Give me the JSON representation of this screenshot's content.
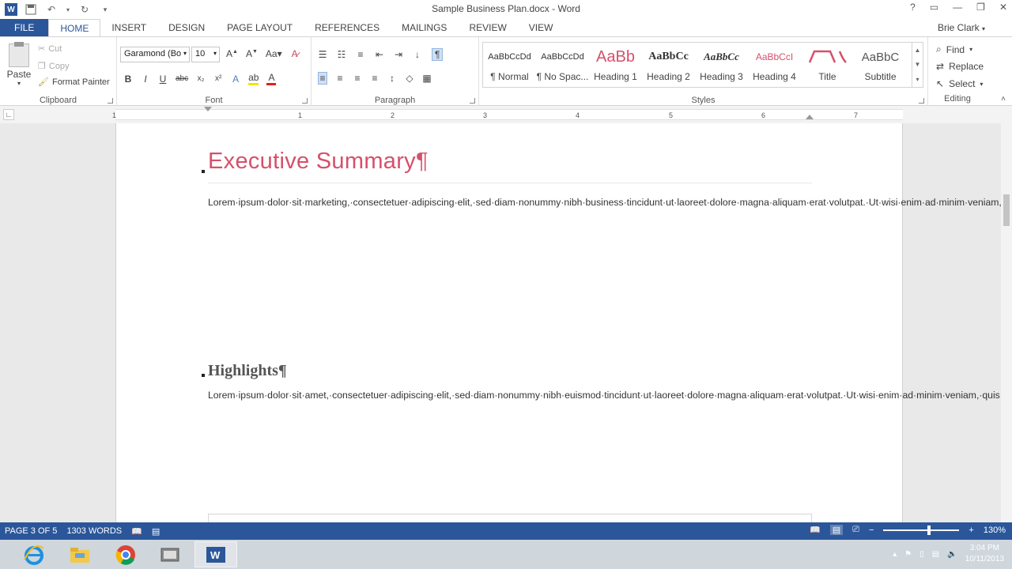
{
  "titlebar": {
    "title": "Sample Business Plan.docx - Word",
    "help": "?",
    "min": "—",
    "restore": "❐",
    "close": "✕"
  },
  "tabs": [
    "FILE",
    "HOME",
    "INSERT",
    "DESIGN",
    "PAGE LAYOUT",
    "REFERENCES",
    "MAILINGS",
    "REVIEW",
    "VIEW"
  ],
  "user": "Brie Clark",
  "clipboard": {
    "paste": "Paste",
    "cut": "Cut",
    "copy": "Copy",
    "format_painter": "Format Painter",
    "label": "Clipboard"
  },
  "font": {
    "name": "Garamond (Bo",
    "size": "10",
    "label": "Font",
    "buttons": [
      "B",
      "I",
      "U",
      "abc",
      "x₂",
      "x²"
    ]
  },
  "paragraph": {
    "label": "Paragraph"
  },
  "styles": {
    "label": "Styles",
    "items": [
      {
        "sample": "AaBbCcDd",
        "name": "¶ Normal"
      },
      {
        "sample": "AaBbCcDd",
        "name": "¶ No Spac..."
      },
      {
        "sample": "AaBb",
        "name": "Heading 1"
      },
      {
        "sample": "AaBbCc",
        "name": "Heading 2"
      },
      {
        "sample": "AaBbCc",
        "name": "Heading 3"
      },
      {
        "sample": "AaBbCcI",
        "name": "Heading 4"
      },
      {
        "sample": "",
        "name": "Title"
      },
      {
        "sample": "AaBbC",
        "name": "Subtitle"
      }
    ]
  },
  "editing": {
    "find": "Find",
    "replace": "Replace",
    "select": "Select",
    "label": "Editing"
  },
  "ruler": {
    "marks": [
      "1",
      "1",
      "2",
      "3",
      "4",
      "5",
      "6",
      "7"
    ]
  },
  "document": {
    "heading1": "Executive Summary¶",
    "para1": "Lorem·ipsum·dolor·sit·marketing,·consectetuer·adipiscing·elit,·sed·diam·nonummy·nibh·business·tincidunt·ut·laoreet·dolore·magna·aliquam·erat·volutpat.·Ut·wisi·enim·ad·minim·veniam,·quis·nostrud·exerci·tation·ullamcorper·suscipit·lobortis·nisl·ut·aliquip·ex·ea·commodo·consequat.·Duis·autem·vel·eum·iriure·dolor·in·hendrerit·in·vulputate·velit·esse·molestie·consequat,·vel·illum·dolore·eu·feugiat·nulla·facilisis·at·vero·eros·et·business·et·iusto·odio·dignissim·qui·blandit·praesent·luptatum·zzril·delenit·augue·duis·dolore·te·feugait·nulla·facilisi.·Nam·liber·tempor·cum·soluta·nobis·eleifend·option·congue·nihil·imperdiet·doming·id·quod·mazim·placerat·facer·possim·assum.·Typi·non·habent·claritatem·insitam;·est·usus·legentis·in·iis·qui·facit·eorum·claritatem.·Investigation·demonstraverunt·lectores·legere·me·lius·quod·ii·legunt·saepius.·Claritas·est·etiam·processus·dynamicus,·qui·sequitur·mutationem·consuetudium·lectorum.·Mirum·est·notare·quam·littera·gothica,·quam·nunc·putamus·parum·claram,·anteposuerit·litterarum·formas·humanitatis·per·seacula·quarta·decima·et·quinta·decima.·Eodem·modo·typi,·qui·nunc·nobis·videntur·parum·clari,·fiant·sollemnes·in·futurum.¶",
    "heading2": "Highlights¶",
    "para2": "Lorem·ipsum·dolor·sit·amet,·consectetuer·adipiscing·elit,·sed·diam·nonummy·nibh·euismod·tincidunt·ut·laoreet·dolore·magna·aliquam·erat·volutpat.·Ut·wisi·enim·ad·minim·veniam,·quis·nostrud·exerci·tation·ullamcorper·suscipit·lobortis·nisl·ut·aliquip·ex·ea·commodo·consequat.·Duis·autem·vel·eum·iriure·dolor·in·hendrerit·in·vulputate·velit·esse·molestie·consequat,·vel·illum·dolore·eu·feugiat·nulla·facilisis·at·vero·eros·et·accumsan·et·iusto·odio·dignissim·qui·blandit·marketing·luptatum·zzril·delenit·augue·duis·dolore·te·feugait·nulla·facilisi.·Mirum·est·notare·quam·littera·gothica,·quam·nunc·putamus·parum·claram,·anteposuerit·litterarum·formas·marketing·per·seacula·quarta·decima·et·quinta·decima.·Eodem·modo·typi,·qui·nunc·nobis·videntur·parum·clari,·fiant·sollemnes·in·futurum.¶"
  },
  "status": {
    "page": "PAGE 3 OF 5",
    "words": "1303 WORDS",
    "zoom": "130%"
  },
  "taskbar": {
    "time": "3:04 PM",
    "date": "10/11/2013"
  },
  "colors": {
    "accent": "#2b579a",
    "heading1": "#d6506b"
  }
}
